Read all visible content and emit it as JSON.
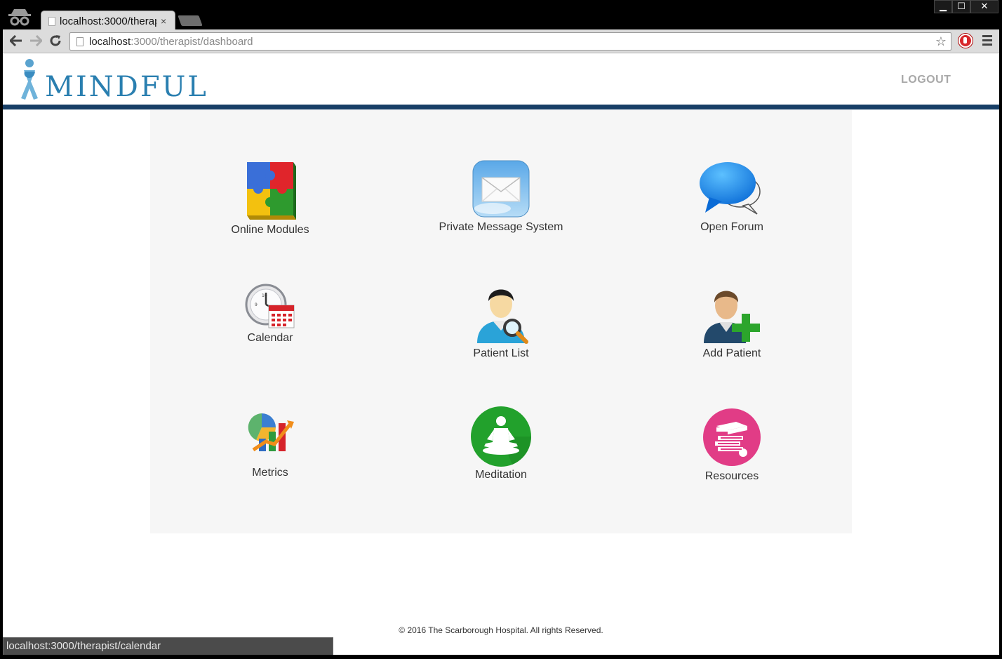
{
  "browser": {
    "tab_title": "localhost:3000/therap",
    "tab_close": "×",
    "url_host": "localhost",
    "url_path": ":3000/therapist/dashboard",
    "status_url": "localhost:3000/therapist/calendar",
    "window_controls": {
      "minimize": "▁",
      "maximize": "☐",
      "close": "✕"
    }
  },
  "header": {
    "logo_text": "MINDFUL",
    "logout_label": "LOGOUT",
    "brand_color": "#2a7fb0",
    "rule_color": "#173e66"
  },
  "tiles": [
    {
      "label": "Online Modules",
      "icon": "puzzle-icon"
    },
    {
      "label": "Private Message System",
      "icon": "envelope-icon"
    },
    {
      "label": "Open Forum",
      "icon": "speech-bubbles-icon"
    },
    {
      "label": "Calendar",
      "icon": "clock-calendar-icon"
    },
    {
      "label": "Patient List",
      "icon": "user-search-icon"
    },
    {
      "label": "Add Patient",
      "icon": "add-user-icon"
    },
    {
      "label": "Metrics",
      "icon": "chart-icon"
    },
    {
      "label": "Meditation",
      "icon": "meditation-icon"
    },
    {
      "label": "Resources",
      "icon": "books-icon"
    }
  ],
  "footer": {
    "copyright": "© 2016 The Scarborough Hospital. All rights Reserved."
  }
}
